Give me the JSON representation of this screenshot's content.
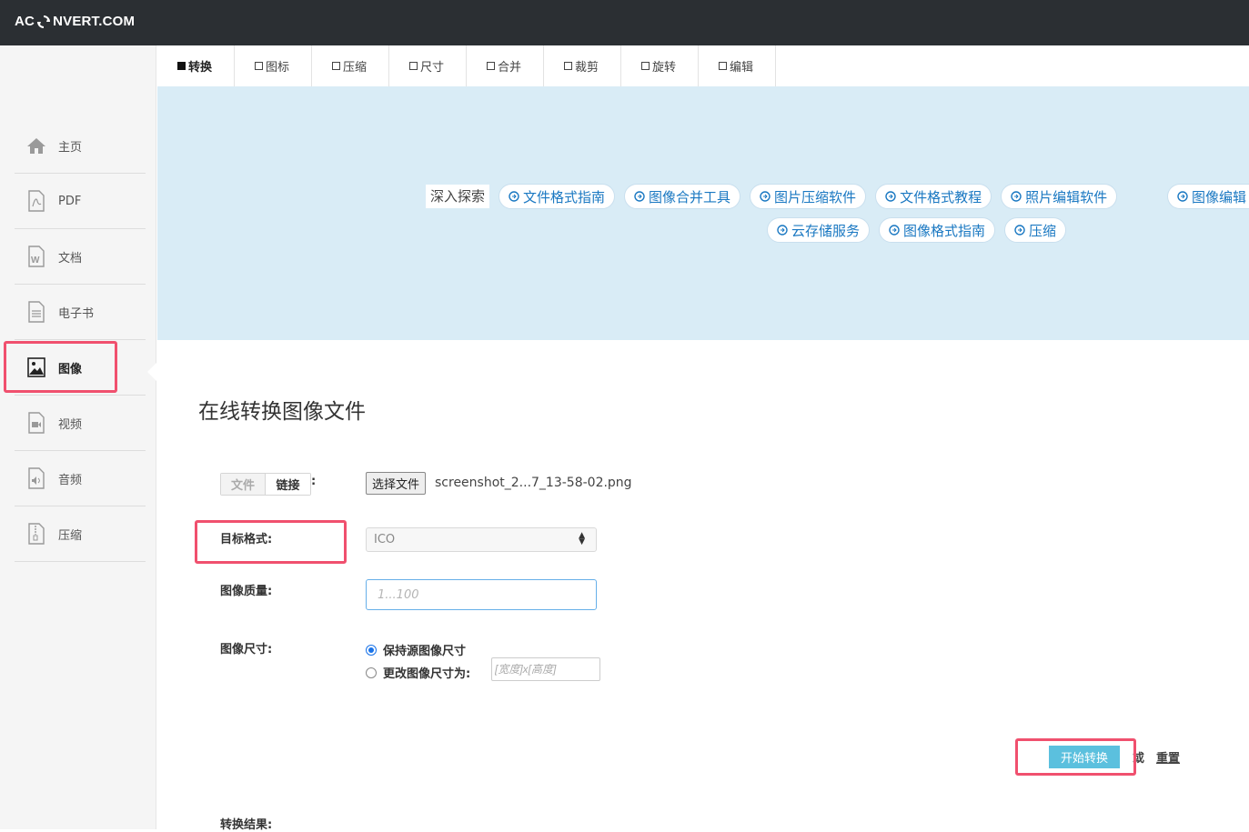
{
  "brand": {
    "logo_left": "AC",
    "logo_right": "NVERT.COM"
  },
  "sidebar": {
    "items": [
      {
        "label": "主页",
        "icon": "home-icon"
      },
      {
        "label": "PDF",
        "icon": "pdf-file-icon"
      },
      {
        "label": "文档",
        "icon": "word-document-icon"
      },
      {
        "label": "电子书",
        "icon": "ebook-icon"
      },
      {
        "label": "图像",
        "icon": "image-icon",
        "active": true
      },
      {
        "label": "视频",
        "icon": "video-icon"
      },
      {
        "label": "音频",
        "icon": "audio-icon"
      },
      {
        "label": "压缩",
        "icon": "archive-icon"
      }
    ]
  },
  "tabs": [
    "转换",
    "图标",
    "压缩",
    "尺寸",
    "合并",
    "裁剪",
    "旋转",
    "编辑"
  ],
  "banner": {
    "explore": "深入探索",
    "row1": [
      "文件格式指南",
      "图像合并工具",
      "图片压缩软件",
      "文件格式教程",
      "照片编辑软件",
      "图像编辑"
    ],
    "row2": [
      "云存储服务",
      "图像格式指南",
      "压缩"
    ]
  },
  "main": {
    "title": "在线转换图像文件",
    "source_toggle": {
      "file": "文件",
      "link": "链接"
    },
    "colon": ":",
    "file_button": "选择文件",
    "file_name": "screenshot_2...7_13-58-02.png",
    "target_format_label": "目标格式:",
    "target_format_value": "ICO",
    "quality_label": "图像质量:",
    "quality_placeholder": "1...100",
    "size_label": "图像尺寸:",
    "size_keep": "保持源图像尺寸",
    "size_change": "更改图像尺寸为:",
    "size_placeholder": "[宽度]x[高度]",
    "start_button": "开始转换",
    "or_text": "或",
    "reset_link": "重置",
    "result_label": "转换结果:"
  },
  "colors": {
    "accent": "#5bc0de",
    "highlight": "#f0506e",
    "banner_bg": "#d9ecf6",
    "link": "#1a78c2"
  }
}
